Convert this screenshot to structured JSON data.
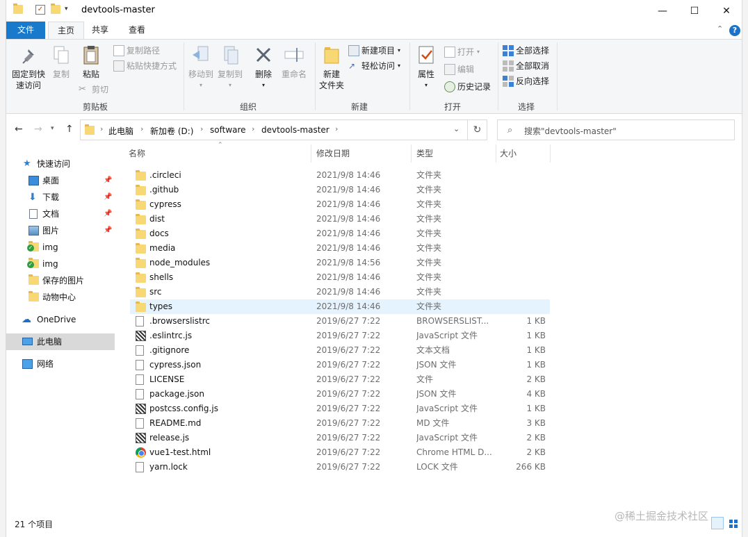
{
  "window": {
    "title": "devtools-master",
    "controls": [
      "—",
      "☐",
      "✕"
    ]
  },
  "ribbon_tabs": [
    {
      "label": "文件"
    },
    {
      "label": "主页"
    },
    {
      "label": "共享"
    },
    {
      "label": "查看"
    }
  ],
  "ribbon": {
    "clipboard": {
      "group_label": "剪贴板",
      "pin_label": "固定到快速访问",
      "pin_line1": "固定到快",
      "pin_line2": "速访问",
      "copy_label": "复制",
      "paste_label": "粘贴",
      "copy_path": "复制路径",
      "paste_shortcut": "粘贴快捷方式",
      "cut": "剪切"
    },
    "organize": {
      "group_label": "组织",
      "move_to": "移动到",
      "copy_to": "复制到",
      "delete": "删除",
      "rename": "重命名"
    },
    "new": {
      "group_label": "新建",
      "new_folder_line1": "新建",
      "new_folder_line2": "文件夹",
      "new_item": "新建项目",
      "easy_access": "轻松访问"
    },
    "open": {
      "group_label": "打开",
      "properties": "属性",
      "open": "打开",
      "edit": "编辑",
      "history": "历史记录"
    },
    "select": {
      "group_label": "选择",
      "select_all": "全部选择",
      "select_none": "全部取消",
      "invert": "反向选择"
    }
  },
  "address": {
    "crumbs": [
      "此电脑",
      "新加卷 (D:)",
      "software",
      "devtools-master"
    ],
    "search_placeholder": "搜索\"devtools-master\""
  },
  "nav": {
    "quick_access": "快速访问",
    "items": [
      {
        "label": "桌面",
        "icon": "desktop-icon",
        "pinned": true
      },
      {
        "label": "下载",
        "icon": "download-icon",
        "pinned": true
      },
      {
        "label": "文档",
        "icon": "document-icon",
        "pinned": true
      },
      {
        "label": "图片",
        "icon": "picture-icon",
        "pinned": true
      },
      {
        "label": "img",
        "icon": "folder-check-icon",
        "pinned": false
      },
      {
        "label": "img",
        "icon": "folder-check-icon",
        "pinned": false
      },
      {
        "label": "保存的图片",
        "icon": "folder-icon",
        "pinned": false
      },
      {
        "label": "动物中心",
        "icon": "folder-icon",
        "pinned": false
      }
    ],
    "onedrive": "OneDrive",
    "this_pc": "此电脑",
    "network": "网络"
  },
  "columns": {
    "name": "名称",
    "date": "修改日期",
    "type": "类型",
    "size": "大小"
  },
  "files": [
    {
      "name": ".circleci",
      "date": "2021/9/8 14:46",
      "type": "文件夹",
      "size": "",
      "icon": "folder"
    },
    {
      "name": ".github",
      "date": "2021/9/8 14:46",
      "type": "文件夹",
      "size": "",
      "icon": "folder"
    },
    {
      "name": "cypress",
      "date": "2021/9/8 14:46",
      "type": "文件夹",
      "size": "",
      "icon": "folder"
    },
    {
      "name": "dist",
      "date": "2021/9/8 14:46",
      "type": "文件夹",
      "size": "",
      "icon": "folder"
    },
    {
      "name": "docs",
      "date": "2021/9/8 14:46",
      "type": "文件夹",
      "size": "",
      "icon": "folder"
    },
    {
      "name": "media",
      "date": "2021/9/8 14:46",
      "type": "文件夹",
      "size": "",
      "icon": "folder"
    },
    {
      "name": "node_modules",
      "date": "2021/9/8 14:56",
      "type": "文件夹",
      "size": "",
      "icon": "folder"
    },
    {
      "name": "shells",
      "date": "2021/9/8 14:46",
      "type": "文件夹",
      "size": "",
      "icon": "folder"
    },
    {
      "name": "src",
      "date": "2021/9/8 14:46",
      "type": "文件夹",
      "size": "",
      "icon": "folder"
    },
    {
      "name": "types",
      "date": "2021/9/8 14:46",
      "type": "文件夹",
      "size": "",
      "icon": "folder"
    },
    {
      "name": ".browserslistrc",
      "date": "2019/6/27 7:22",
      "type": "BROWSERSLIST...",
      "size": "1 KB",
      "icon": "doc"
    },
    {
      "name": ".eslintrc.js",
      "date": "2019/6/27 7:22",
      "type": "JavaScript 文件",
      "size": "1 KB",
      "icon": "js"
    },
    {
      "name": ".gitignore",
      "date": "2019/6/27 7:22",
      "type": "文本文档",
      "size": "1 KB",
      "icon": "doc"
    },
    {
      "name": "cypress.json",
      "date": "2019/6/27 7:22",
      "type": "JSON 文件",
      "size": "1 KB",
      "icon": "doc"
    },
    {
      "name": "LICENSE",
      "date": "2019/6/27 7:22",
      "type": "文件",
      "size": "2 KB",
      "icon": "doc"
    },
    {
      "name": "package.json",
      "date": "2019/6/27 7:22",
      "type": "JSON 文件",
      "size": "4 KB",
      "icon": "doc"
    },
    {
      "name": "postcss.config.js",
      "date": "2019/6/27 7:22",
      "type": "JavaScript 文件",
      "size": "1 KB",
      "icon": "js"
    },
    {
      "name": "README.md",
      "date": "2019/6/27 7:22",
      "type": "MD 文件",
      "size": "3 KB",
      "icon": "doc"
    },
    {
      "name": "release.js",
      "date": "2019/6/27 7:22",
      "type": "JavaScript 文件",
      "size": "2 KB",
      "icon": "js"
    },
    {
      "name": "vue1-test.html",
      "date": "2019/6/27 7:22",
      "type": "Chrome HTML D...",
      "size": "2 KB",
      "icon": "chrome"
    },
    {
      "name": "yarn.lock",
      "date": "2019/6/27 7:22",
      "type": "LOCK 文件",
      "size": "266 KB",
      "icon": "doc"
    }
  ],
  "hover_row": 9,
  "status": {
    "count": "21 个项目"
  },
  "watermark": "@稀土掘金技术社区",
  "colors": {
    "file_tab": "#1979ca",
    "selection": "#e5f3ff",
    "folder": "#f8d775"
  }
}
